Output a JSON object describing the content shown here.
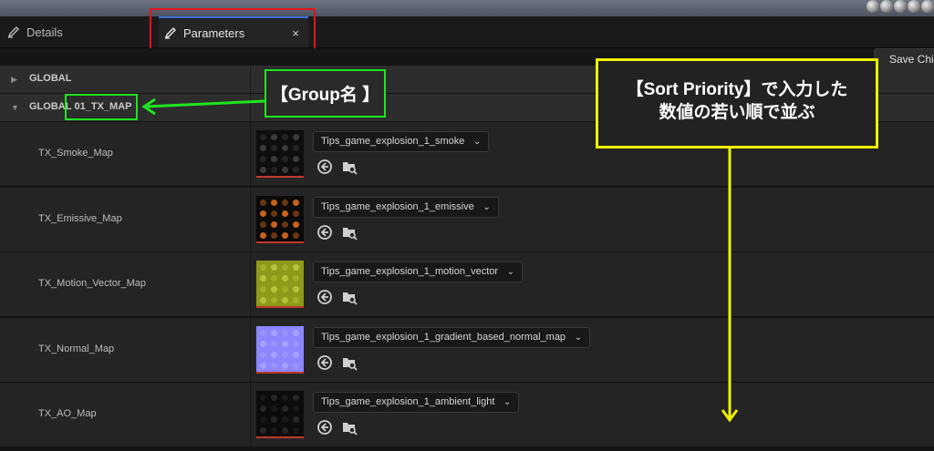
{
  "tabs": {
    "details_label": "Details",
    "parameters_label": "Parameters",
    "close_glyph": "×"
  },
  "toolbar": {
    "save_child_label": "Save Child"
  },
  "groups": {
    "global_label": "GLOBAL",
    "tx_prefix": "GLOBAL",
    "tx_label": "01_TX_MAP"
  },
  "params": [
    {
      "name": "TX_Smoke_Map",
      "texture": "Tips_game_explosion_1_smoke",
      "thumb": "smoke"
    },
    {
      "name": "TX_Emissive_Map",
      "texture": "Tips_game_explosion_1_emissive",
      "thumb": "emissive"
    },
    {
      "name": "TX_Motion_Vector_Map",
      "texture": "Tips_game_explosion_1_motion_vector",
      "thumb": "motion"
    },
    {
      "name": "TX_Normal_Map",
      "texture": "Tips_game_explosion_1_gradient_based_normal_map",
      "thumb": "normal"
    },
    {
      "name": "TX_AO_Map",
      "texture": "Tips_game_explosion_1_ambient_light",
      "thumb": "ao"
    }
  ],
  "annotations": {
    "group_name": "【Group名 】",
    "sort_priority_line1": "【Sort Priority】で入力した",
    "sort_priority_line2": "数値の若い順で並ぶ"
  },
  "icons": {
    "pencil": "pencil-icon",
    "reset": "reset-arrow-icon",
    "browse": "browse-folder-icon",
    "dropdown": "chevron-down-icon"
  },
  "colors": {
    "highlight_red": "#e0141c",
    "highlight_green": "#1ee51e",
    "highlight_yellow": "#f0f000",
    "active_tab": "#242424"
  }
}
